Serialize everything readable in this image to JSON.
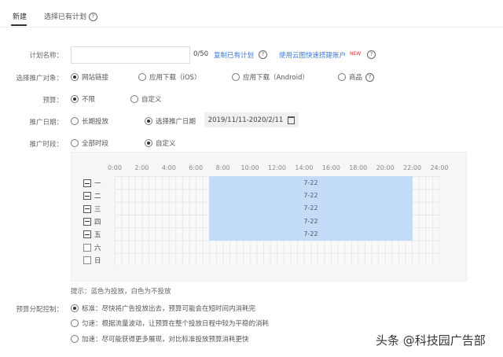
{
  "tabs": [
    {
      "label": "新建"
    },
    {
      "label": "选择已有计划"
    }
  ],
  "form": {
    "plan_name": {
      "label": "计划名称：",
      "value": "",
      "counter": "0/50",
      "copy_link": "复制已有计划",
      "cloud_link": "使用云图快速搭建账户",
      "new_badge": "NEW"
    },
    "target": {
      "label": "选择推广对象：",
      "options": [
        "网站链接",
        "应用下载（iOS）",
        "应用下载（Android）",
        "商品"
      ],
      "selected": 0
    },
    "budget": {
      "label": "预算：",
      "options": [
        "不限",
        "自定义"
      ],
      "selected": 0
    },
    "date": {
      "label": "推广日期：",
      "options": [
        "长期投放",
        "选择推广日期"
      ],
      "selected": 1,
      "range": "2019/11/11-2020/2/11"
    },
    "period": {
      "label": "推广时段：",
      "options": [
        "全部时段",
        "自定义"
      ],
      "selected": 1
    },
    "hours": [
      "0:00",
      "2:00",
      "4:00",
      "6:00",
      "8:00",
      "10:00",
      "12:00",
      "14:00",
      "16:00",
      "18:00",
      "20:00",
      "22:00",
      "24:00"
    ],
    "days": [
      {
        "name": "一",
        "state": "partial",
        "start": 7,
        "end": 22,
        "text": "7-22"
      },
      {
        "name": "二",
        "state": "partial",
        "start": 7,
        "end": 22,
        "text": "7-22"
      },
      {
        "name": "三",
        "state": "partial",
        "start": 7,
        "end": 22,
        "text": "7-22"
      },
      {
        "name": "四",
        "state": "partial",
        "start": 7,
        "end": 22,
        "text": "7-22"
      },
      {
        "name": "五",
        "state": "partial",
        "start": 7,
        "end": 22,
        "text": "7-22"
      },
      {
        "name": "六",
        "state": "off"
      },
      {
        "name": "日",
        "state": "off"
      }
    ],
    "hint": "提示：蓝色为投放，白色为不投放",
    "pacing": {
      "label": "预算分配控制：",
      "options": [
        "标准：尽快将广告投放出去，预算可能会在短时间内消耗完",
        "匀速：根据流量波动，让预算在整个投放日程中较为平稳的消耗",
        "加速：尽可能获得更多展现，对比标准投放预算消耗更快"
      ],
      "selected": 0
    }
  },
  "watermark": "头条 @科技园广告部",
  "colors": {
    "accent": "#3a7bd5",
    "schedule_blue": "#c3ddf8",
    "new_badge": "#e03030"
  }
}
